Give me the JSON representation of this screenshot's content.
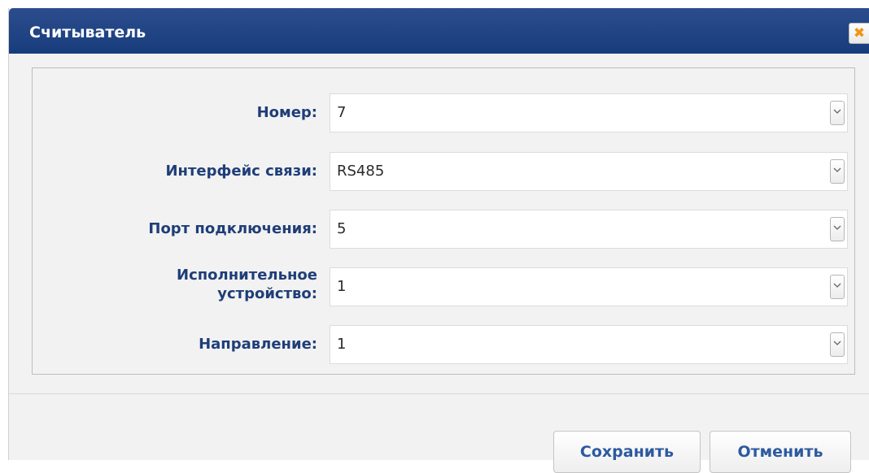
{
  "dialog": {
    "title": "Считыватель",
    "close_icon": "close-x-icon",
    "accent_color": "#f29412",
    "titlebar_color": "#1f4382"
  },
  "form": {
    "fields": [
      {
        "label": "Номер:",
        "value": "7"
      },
      {
        "label": "Интерфейс связи:",
        "value": "RS485"
      },
      {
        "label": "Порт подключения:",
        "value": "5"
      },
      {
        "label_line1": "Исполнительное",
        "label_line2": "устройство:",
        "value": "1"
      },
      {
        "label": "Направление:",
        "value": "1"
      }
    ]
  },
  "footer": {
    "save_label": "Сохранить",
    "cancel_label": "Отменить"
  }
}
